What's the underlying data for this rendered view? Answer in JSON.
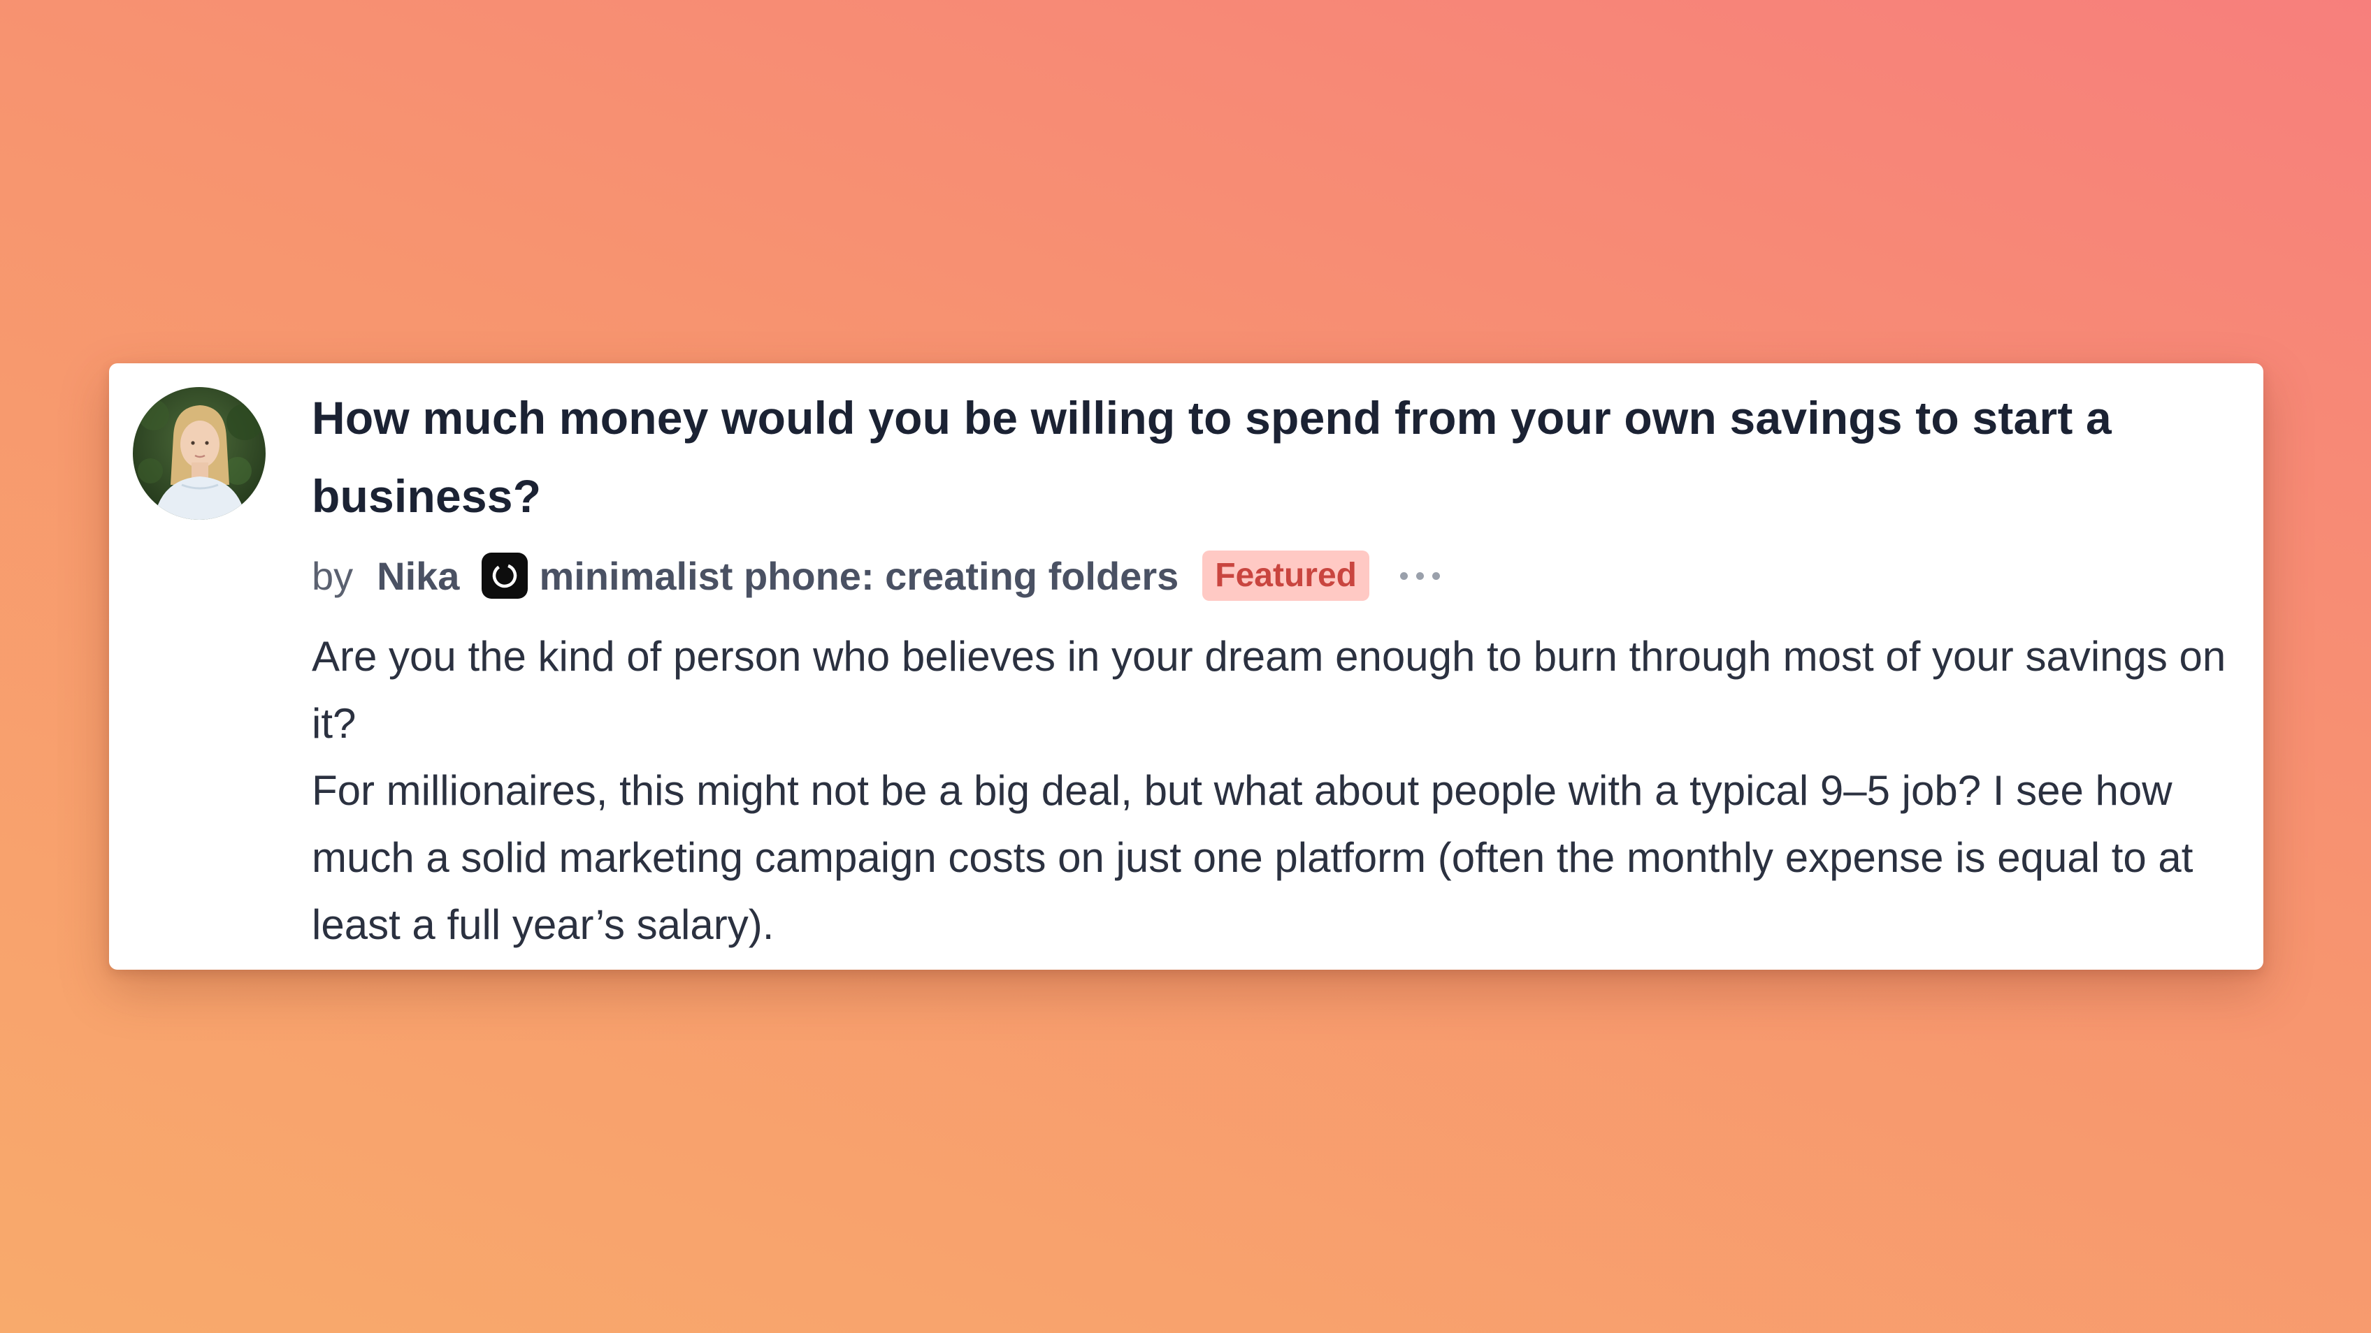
{
  "post": {
    "title": "How much money would you be willing to spend from your own savings to start a business?",
    "by_label": "by",
    "author": "Nika",
    "product": "minimalist phone: creating folders",
    "badge": "Featured",
    "paragraphs": [
      "Are you the kind of person who believes in your dream enough to burn through most of your savings on it?",
      "For millionaires, this might not be a big deal, but what about people with a typical 9–5 job? I see how much a solid marketing campaign costs on just one platform (often the monthly expense is equal to at least a full year’s salary)."
    ]
  },
  "icons": {
    "avatar": "author-avatar",
    "product_logo": "product-logo-icon",
    "more": "more-options-icon"
  },
  "colors": {
    "badge_bg": "#ffc9c4",
    "badge_text": "#c9453f",
    "title": "#1b2233",
    "body": "#2b3140"
  }
}
